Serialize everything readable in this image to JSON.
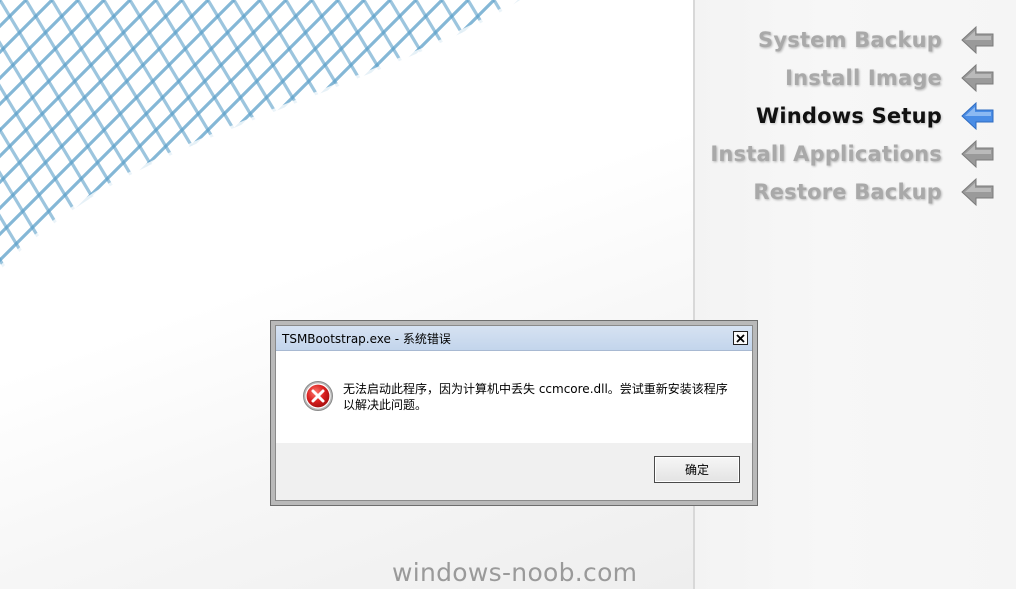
{
  "steps": [
    {
      "label": "System Backup",
      "state": "pending",
      "arrow_color": "#9a9a9a"
    },
    {
      "label": "Install Image",
      "state": "pending",
      "arrow_color": "#9a9a9a"
    },
    {
      "label": "Windows Setup",
      "state": "active",
      "arrow_color": "#4a8de6"
    },
    {
      "label": "Install Applications",
      "state": "pending",
      "arrow_color": "#9a9a9a"
    },
    {
      "label": "Restore Backup",
      "state": "pending",
      "arrow_color": "#9a9a9a"
    }
  ],
  "dialog": {
    "title": "TSMBootstrap.exe - 系统错误",
    "icon": "error-icon",
    "message": "无法启动此程序，因为计算机中丢失 ccmcore.dll。尝试重新安装该程序以解决此问题。",
    "ok_label": "确定",
    "close_label": "✕"
  },
  "watermark": "windows-noob.com",
  "colors": {
    "mesh_blue": "#5b9fc9",
    "active_arrow": "#4a8de6",
    "inactive_arrow": "#9a9a9a",
    "error_red": "#d81e1e"
  }
}
